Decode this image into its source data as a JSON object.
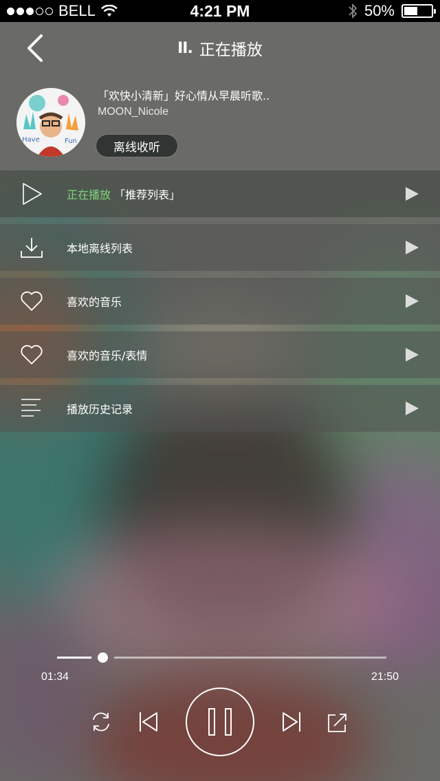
{
  "status_bar": {
    "carrier": "BELL",
    "time": "4:21 PM",
    "battery_percent": "50%",
    "battery_level": 0.5,
    "signal_filled": 3,
    "signal_total": 5
  },
  "header": {
    "back_icon": "chevron-left-icon",
    "now_playing_icon": "pause-bars-icon",
    "title": "正在播放"
  },
  "playlist": {
    "title": "「欢快小清新」好心情从早晨听歌..",
    "user": "MOON_Nicole",
    "offline_label": "离线收听",
    "avatar_text_left": "Have",
    "avatar_text_right": "Fun"
  },
  "menu": {
    "items": [
      {
        "icon": "play-outline-icon",
        "prefix": "正在播放",
        "label": "「推荐列表」",
        "active": true
      },
      {
        "icon": "download-icon",
        "label": "本地离线列表"
      },
      {
        "icon": "heart-icon",
        "label": "喜欢的音乐"
      },
      {
        "icon": "heart-icon",
        "label": "喜欢的音乐/表情"
      },
      {
        "icon": "list-icon",
        "label": "播放历史记录"
      }
    ]
  },
  "player": {
    "current_time": "01:34",
    "total_time": "21:50",
    "progress": 0.07
  },
  "colors": {
    "accent_green": "#7fd47c",
    "status_bar_bg": "#000000"
  }
}
